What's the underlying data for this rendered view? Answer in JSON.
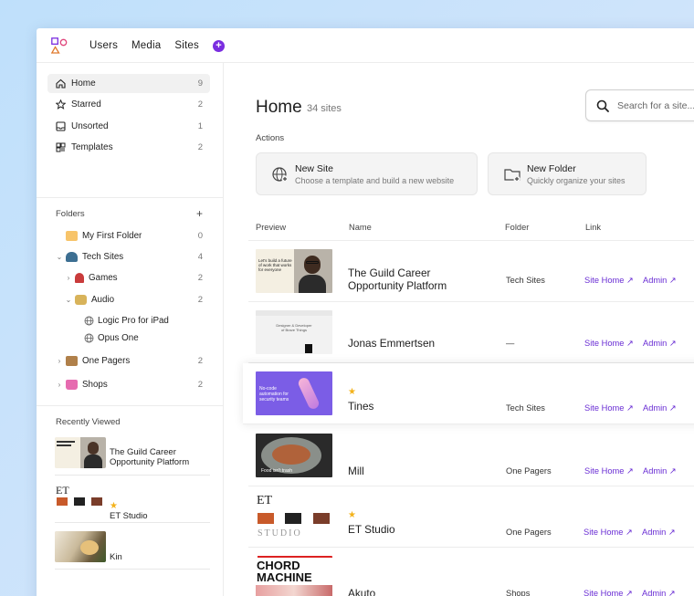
{
  "nav": {
    "users": "Users",
    "media": "Media",
    "sites": "Sites",
    "add": "+"
  },
  "sidebar": {
    "items": [
      {
        "label": "Home",
        "count": "9",
        "icon": "home-icon"
      },
      {
        "label": "Starred",
        "count": "2",
        "icon": "star-icon"
      },
      {
        "label": "Unsorted",
        "count": "1",
        "icon": "inbox-icon"
      },
      {
        "label": "Templates",
        "count": "2",
        "icon": "templates-icon"
      }
    ],
    "folders_title": "Folders",
    "folders_add": "+",
    "folders": [
      {
        "label": "My First Folder",
        "count": "0"
      },
      {
        "label": "Tech Sites",
        "count": "4"
      },
      {
        "label": "Games",
        "count": "2"
      },
      {
        "label": "Audio",
        "count": "2"
      },
      {
        "label": "Logic Pro for iPad"
      },
      {
        "label": "Opus One"
      },
      {
        "label": "One Pagers",
        "count": "2"
      },
      {
        "label": "Shops",
        "count": "2"
      }
    ],
    "recent_title": "Recently Viewed",
    "recent": [
      {
        "label": "The Guild Career Opportunity Platform"
      },
      {
        "label": "ET Studio",
        "star": "★"
      },
      {
        "label": "Kin"
      }
    ]
  },
  "main": {
    "title": "Home",
    "subtitle": "34 sites",
    "search_placeholder": "Search for a site...",
    "actions_label": "Actions",
    "actions": [
      {
        "title": "New Site",
        "desc": "Choose a template and build a new website"
      },
      {
        "title": "New Folder",
        "desc": "Quickly organize your sites"
      }
    ],
    "columns": {
      "preview": "Preview",
      "name": "Name",
      "folder": "Folder",
      "link": "Link"
    },
    "rows": [
      {
        "name": "The Guild Career Opportunity Platform",
        "folder": "Tech Sites",
        "site_home": "Site Home ↗",
        "admin": "Admin ↗",
        "star": ""
      },
      {
        "name": "Jonas Emmertsen",
        "folder": "—",
        "site_home": "Site Home ↗",
        "admin": "Admin ↗",
        "star": ""
      },
      {
        "name": "Tines",
        "folder": "Tech Sites",
        "site_home": "Site Home ↗",
        "admin": "Admin ↗",
        "star": "★"
      },
      {
        "name": "Mill",
        "folder": "One Pagers",
        "site_home": "Site Home ↗",
        "admin": "Admin ↗",
        "star": ""
      },
      {
        "name": "ET Studio",
        "folder": "One Pagers",
        "site_home": "Site Home ↗",
        "admin": "Admin ↗",
        "star": "★"
      },
      {
        "name": "Akuto",
        "folder": "Shops",
        "site_home": "Site Home ↗",
        "admin": "Admin ↗",
        "star": ""
      }
    ],
    "thumb_text": {
      "guild": "Let's build a future of work that works for everyone",
      "jonas": "Designer & Developer of Brave Things",
      "tines": "No-code automation for security teams",
      "mill": "Food isn't trash",
      "et": "ET",
      "et_studio": "STUDIO",
      "akuto_1": "CHORD",
      "akuto_2": "MACHINE"
    }
  },
  "colors": {
    "accent": "#6a2ed4",
    "star": "#f3b21b",
    "nav_add": "#7a2de0"
  }
}
